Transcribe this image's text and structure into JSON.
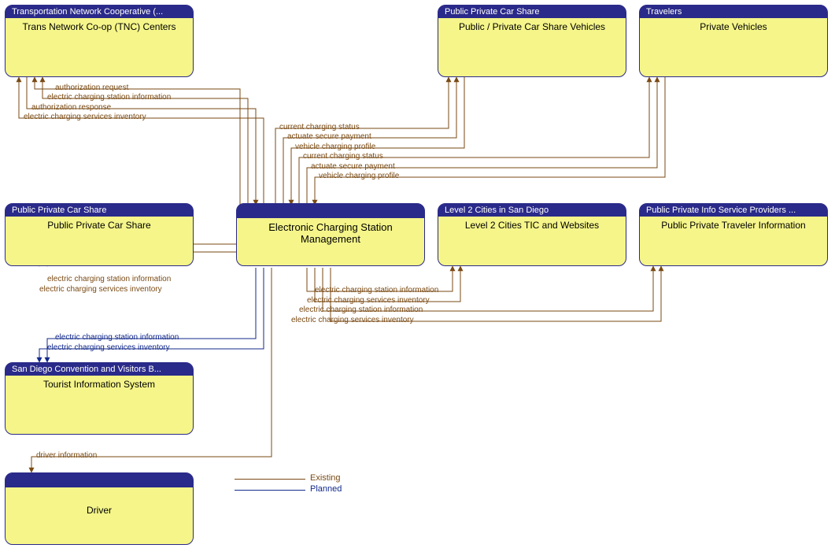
{
  "nodes": {
    "tnc": {
      "header": "Transportation Network Cooperative (...",
      "body": "Trans Network Co-op (TNC) Centers"
    },
    "carshare_veh": {
      "header": "Public Private Car Share",
      "body": "Public / Private Car Share Vehicles"
    },
    "travelers": {
      "header": "Travelers",
      "body": "Private Vehicles"
    },
    "carshare": {
      "header": "Public Private Car Share",
      "body": "Public Private Car Share"
    },
    "ecsm": {
      "header": "",
      "body": "Electronic Charging Station Management"
    },
    "l2": {
      "header": "Level 2 Cities in San Diego",
      "body": "Level 2 Cities TIC and Websites"
    },
    "pti": {
      "header": "Public Private Info Service Providers ...",
      "body": "Public Private Traveler Information"
    },
    "tourist": {
      "header": "San Diego Convention and Visitors B...",
      "body": "Tourist Information System"
    },
    "driver": {
      "header": "",
      "body": "Driver"
    }
  },
  "flows": {
    "tnc_auth_req": "authorization request",
    "tnc_ecsi": "electric charging station information",
    "tnc_auth_resp": "authorization response",
    "tnc_inv": "electric charging services inventory",
    "veh_ccs1": "current charging status",
    "veh_asp1": "actuate secure payment",
    "veh_vcp1": "vehicle charging profile",
    "veh_ccs2": "current charging status",
    "veh_asp2": "actuate secure payment",
    "veh_vcp2": "vehicle charging profile",
    "cs_ecsi": "electric charging station information",
    "cs_inv": "electric charging services inventory",
    "l2_ecsi": "electric charging station information",
    "l2_inv": "electric charging services inventory",
    "pti_ecsi": "electric charging station information",
    "pti_inv": "electric charging services inventory",
    "tis_ecsi": "electric charging station information",
    "tis_inv": "electric charging services inventory",
    "drv_info": "driver information"
  },
  "legend": {
    "existing": "Existing",
    "planned": "Planned"
  },
  "colors": {
    "existing": "#7a4a13",
    "planned": "#132a8a",
    "node_fill": "#f5f58a",
    "node_border": "#2a2a8a"
  },
  "chart_data": {
    "type": "diagram",
    "title": "Electronic Charging Station Management context diagram",
    "center": "Electronic Charging Station Management",
    "entities": [
      {
        "name": "Trans Network Co-op (TNC) Centers",
        "stakeholder": "Transportation Network Cooperative"
      },
      {
        "name": "Public / Private Car Share Vehicles",
        "stakeholder": "Public Private Car Share"
      },
      {
        "name": "Private Vehicles",
        "stakeholder": "Travelers"
      },
      {
        "name": "Public Private Car Share",
        "stakeholder": "Public Private Car Share"
      },
      {
        "name": "Electronic Charging Station Management",
        "stakeholder": ""
      },
      {
        "name": "Level 2 Cities TIC and Websites",
        "stakeholder": "Level 2 Cities in San Diego"
      },
      {
        "name": "Public Private Traveler Information",
        "stakeholder": "Public Private Info Service Providers"
      },
      {
        "name": "Tourist Information System",
        "stakeholder": "San Diego Convention and Visitors Bureau"
      },
      {
        "name": "Driver",
        "stakeholder": ""
      }
    ],
    "flows": [
      {
        "from": "Trans Network Co-op (TNC) Centers",
        "to": "Electronic Charging Station Management",
        "label": "authorization request",
        "status": "existing"
      },
      {
        "from": "Electronic Charging Station Management",
        "to": "Trans Network Co-op (TNC) Centers",
        "label": "electric charging station information",
        "status": "existing"
      },
      {
        "from": "Electronic Charging Station Management",
        "to": "Trans Network Co-op (TNC) Centers",
        "label": "authorization response",
        "status": "existing"
      },
      {
        "from": "Electronic Charging Station Management",
        "to": "Trans Network Co-op (TNC) Centers",
        "label": "electric charging services inventory",
        "status": "existing"
      },
      {
        "from": "Electronic Charging Station Management",
        "to": "Public / Private Car Share Vehicles",
        "label": "current charging status",
        "status": "existing"
      },
      {
        "from": "Electronic Charging Station Management",
        "to": "Public / Private Car Share Vehicles",
        "label": "actuate secure payment",
        "status": "existing"
      },
      {
        "from": "Public / Private Car Share Vehicles",
        "to": "Electronic Charging Station Management",
        "label": "vehicle charging profile",
        "status": "existing"
      },
      {
        "from": "Electronic Charging Station Management",
        "to": "Private Vehicles",
        "label": "current charging status",
        "status": "existing"
      },
      {
        "from": "Electronic Charging Station Management",
        "to": "Private Vehicles",
        "label": "actuate secure payment",
        "status": "existing"
      },
      {
        "from": "Private Vehicles",
        "to": "Electronic Charging Station Management",
        "label": "vehicle charging profile",
        "status": "existing"
      },
      {
        "from": "Electronic Charging Station Management",
        "to": "Public Private Car Share",
        "label": "electric charging station information",
        "status": "existing"
      },
      {
        "from": "Electronic Charging Station Management",
        "to": "Public Private Car Share",
        "label": "electric charging services inventory",
        "status": "existing"
      },
      {
        "from": "Electronic Charging Station Management",
        "to": "Level 2 Cities TIC and Websites",
        "label": "electric charging station information",
        "status": "existing"
      },
      {
        "from": "Electronic Charging Station Management",
        "to": "Level 2 Cities TIC and Websites",
        "label": "electric charging services inventory",
        "status": "existing"
      },
      {
        "from": "Electronic Charging Station Management",
        "to": "Public Private Traveler Information",
        "label": "electric charging station information",
        "status": "existing"
      },
      {
        "from": "Electronic Charging Station Management",
        "to": "Public Private Traveler Information",
        "label": "electric charging services inventory",
        "status": "existing"
      },
      {
        "from": "Electronic Charging Station Management",
        "to": "Tourist Information System",
        "label": "electric charging station information",
        "status": "planned"
      },
      {
        "from": "Electronic Charging Station Management",
        "to": "Tourist Information System",
        "label": "electric charging services inventory",
        "status": "planned"
      },
      {
        "from": "Electronic Charging Station Management",
        "to": "Driver",
        "label": "driver information",
        "status": "existing"
      }
    ]
  }
}
